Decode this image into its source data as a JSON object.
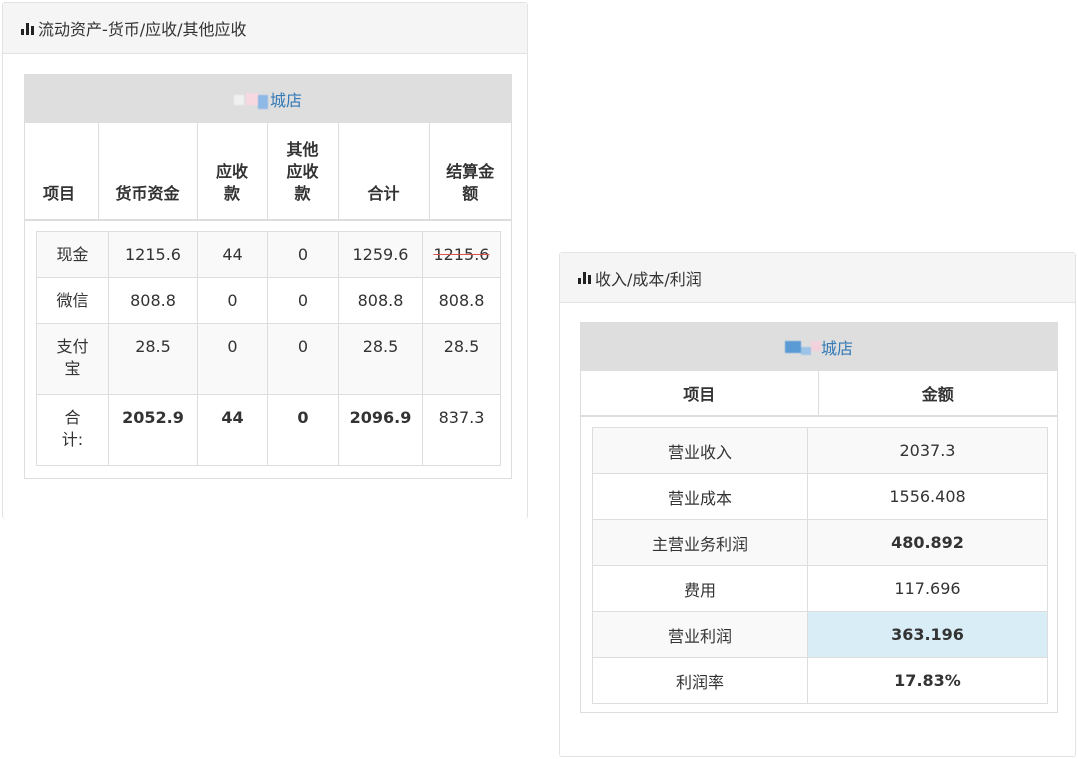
{
  "left_panel": {
    "title": "流动资产-货币/应收/其他应收",
    "store_name": "城店",
    "headers": [
      "项目",
      "货币资金",
      "应收款",
      "其他应收款",
      "合计",
      "结算金额"
    ],
    "rows": [
      {
        "item": "现金",
        "cash": "1215.6",
        "receivable": "44",
        "other_receivable": "0",
        "total": "1259.6",
        "settlement": "1215.6"
      },
      {
        "item": "微信",
        "cash": "808.8",
        "receivable": "0",
        "other_receivable": "0",
        "total": "808.8",
        "settlement": "808.8"
      },
      {
        "item": "支付宝",
        "cash": "28.5",
        "receivable": "0",
        "other_receivable": "0",
        "total": "28.5",
        "settlement": "28.5"
      },
      {
        "item": "合计:",
        "cash": "2052.9",
        "receivable": "44",
        "other_receivable": "0",
        "total": "2096.9",
        "settlement": "837.3"
      }
    ]
  },
  "right_panel": {
    "title": "收入/成本/利润",
    "store_name": "城店",
    "headers": [
      "项目",
      "金额"
    ],
    "rows": [
      {
        "item": "营业收入",
        "amount": "2037.3"
      },
      {
        "item": "营业成本",
        "amount": "1556.408"
      },
      {
        "item": "主营业务利润",
        "amount": "480.892"
      },
      {
        "item": "费用",
        "amount": "117.696"
      },
      {
        "item": "营业利润",
        "amount": "363.196"
      },
      {
        "item": "利润率",
        "amount": "17.83%"
      }
    ]
  },
  "icons": {
    "panel_icon": "bar-chart-icon"
  },
  "colors": {
    "link": "#337ab7",
    "highlight": "#d9edf7",
    "strike": "#d9534f"
  }
}
